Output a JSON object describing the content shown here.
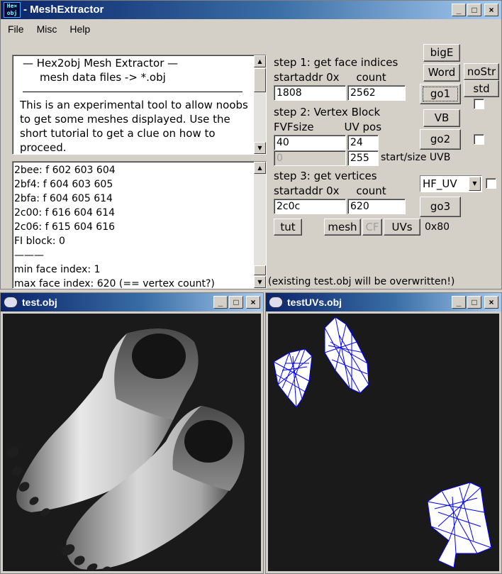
{
  "app": {
    "title": "MeshExtractor",
    "icon_text_1": "He×",
    "icon_text_2": "obj",
    "icon": "hex2obj-icon"
  },
  "window_buttons": {
    "minimize": "_",
    "maximize": "□",
    "close": "×"
  },
  "menu": [
    "File",
    "Misc",
    "Help"
  ],
  "info": {
    "line1": "—   Hex2obj Mesh Extractor   —",
    "line2": "mesh data files -> *.obj",
    "rule": "————————————————",
    "body": "This is an experimental tool to allow noobs to get some meshes displayed. Use the short tutorial to get a clue on how to proceed."
  },
  "log": [
    "2bee: f  602 603 604",
    "2bf4: f  604 603 605",
    "2bfa: f  604 605 614",
    "2c00: f  616 604 614",
    "2c06: f  615 604 616",
    "FI block: 0",
    "———",
    "min face index: 1",
    "max face index: 620 (== vertex count?)"
  ],
  "step1": {
    "title": "step 1: get face indices",
    "labels": "startaddr 0x     count",
    "startaddr": "1808",
    "count": "2562"
  },
  "step2": {
    "title": "step 2: Vertex Block",
    "labels": "FVFsize         UV pos",
    "fvf": "40",
    "uvpos": "24",
    "uvb_start": "0",
    "uvb_size": "255",
    "uvb_label": "start/size UVB"
  },
  "step3": {
    "title": "step 3: get vertices",
    "labels": "startaddr 0x     count",
    "startaddr": "2c0c",
    "count": "620",
    "uv_mode": "HF_UV"
  },
  "buttons": {
    "bigE": "bigE",
    "word": "Word",
    "nostr": "noStr",
    "std": "std",
    "go1": "go1",
    "vb": "VB",
    "go2": "go2",
    "go3": "go3",
    "tut": "tut",
    "mesh": "mesh",
    "cf": "CF",
    "uvs": "UVs",
    "hex": "0x80"
  },
  "warning": "(existing test.obj will be overwritten!)",
  "mesh_window": {
    "title": "test.obj"
  },
  "uv_window": {
    "title": "testUVs.obj"
  },
  "colors": {
    "title_start": "#0a246a",
    "title_end": "#a6caf0",
    "face": "#d4d0c8",
    "viewport": "#1a1a1a",
    "wire": "#0000ff"
  }
}
